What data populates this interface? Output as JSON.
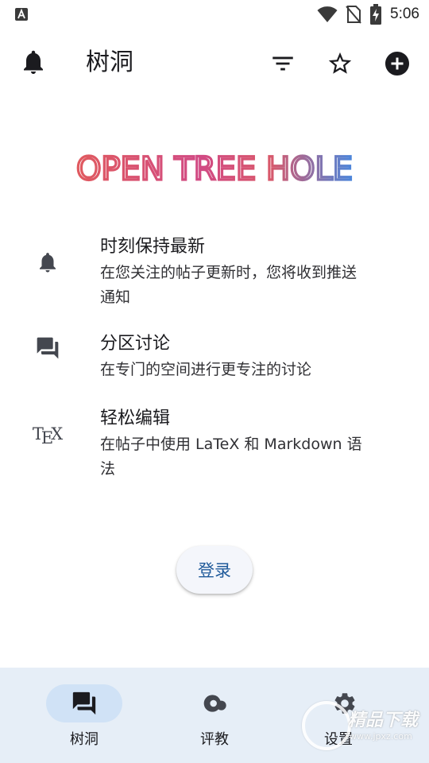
{
  "status_bar": {
    "time": "5:06",
    "icons": [
      "a-notification-icon",
      "wifi-icon",
      "no-sim-icon",
      "battery-charging-icon"
    ]
  },
  "app_bar": {
    "title": "树洞",
    "icons": [
      "bell-icon",
      "filter-icon",
      "star-outline-icon",
      "add-circle-icon"
    ]
  },
  "logo": {
    "text": "OPEN TREE HOLE",
    "colors": [
      "#e05a5f",
      "#c9468f",
      "#4a7fd8",
      "#5a8ee0"
    ]
  },
  "features": [
    {
      "icon": "bell-icon",
      "title": "时刻保持最新",
      "desc_lines": [
        "在您关注的帖子更新时，您将收到推送",
        "通知"
      ]
    },
    {
      "icon": "forum-icon",
      "title": "分区讨论",
      "desc_lines": [
        "在专门的空间进行更专注的讨论"
      ]
    },
    {
      "icon": "tex-icon",
      "icon_text": {
        "t": "T",
        "e": "E",
        "x": "X"
      },
      "title": "轻松编辑",
      "desc_lines": [
        "在帖子中使用 LaTeX 和 Markdown 语",
        "法"
      ]
    }
  ],
  "login": {
    "label": "登录",
    "color": "#1f5a9a"
  },
  "bottom_nav": {
    "items": [
      {
        "icon": "forum-icon",
        "label": "树洞",
        "active": true
      },
      {
        "icon": "review-icon",
        "label": "评教",
        "active": false
      },
      {
        "icon": "gear-icon",
        "label": "设置",
        "active": false
      }
    ],
    "background": "#e6eef7",
    "active_pill": "#d0e2f6"
  },
  "watermark": {
    "text": "精品下载",
    "sub": "www.jpxz.com"
  }
}
